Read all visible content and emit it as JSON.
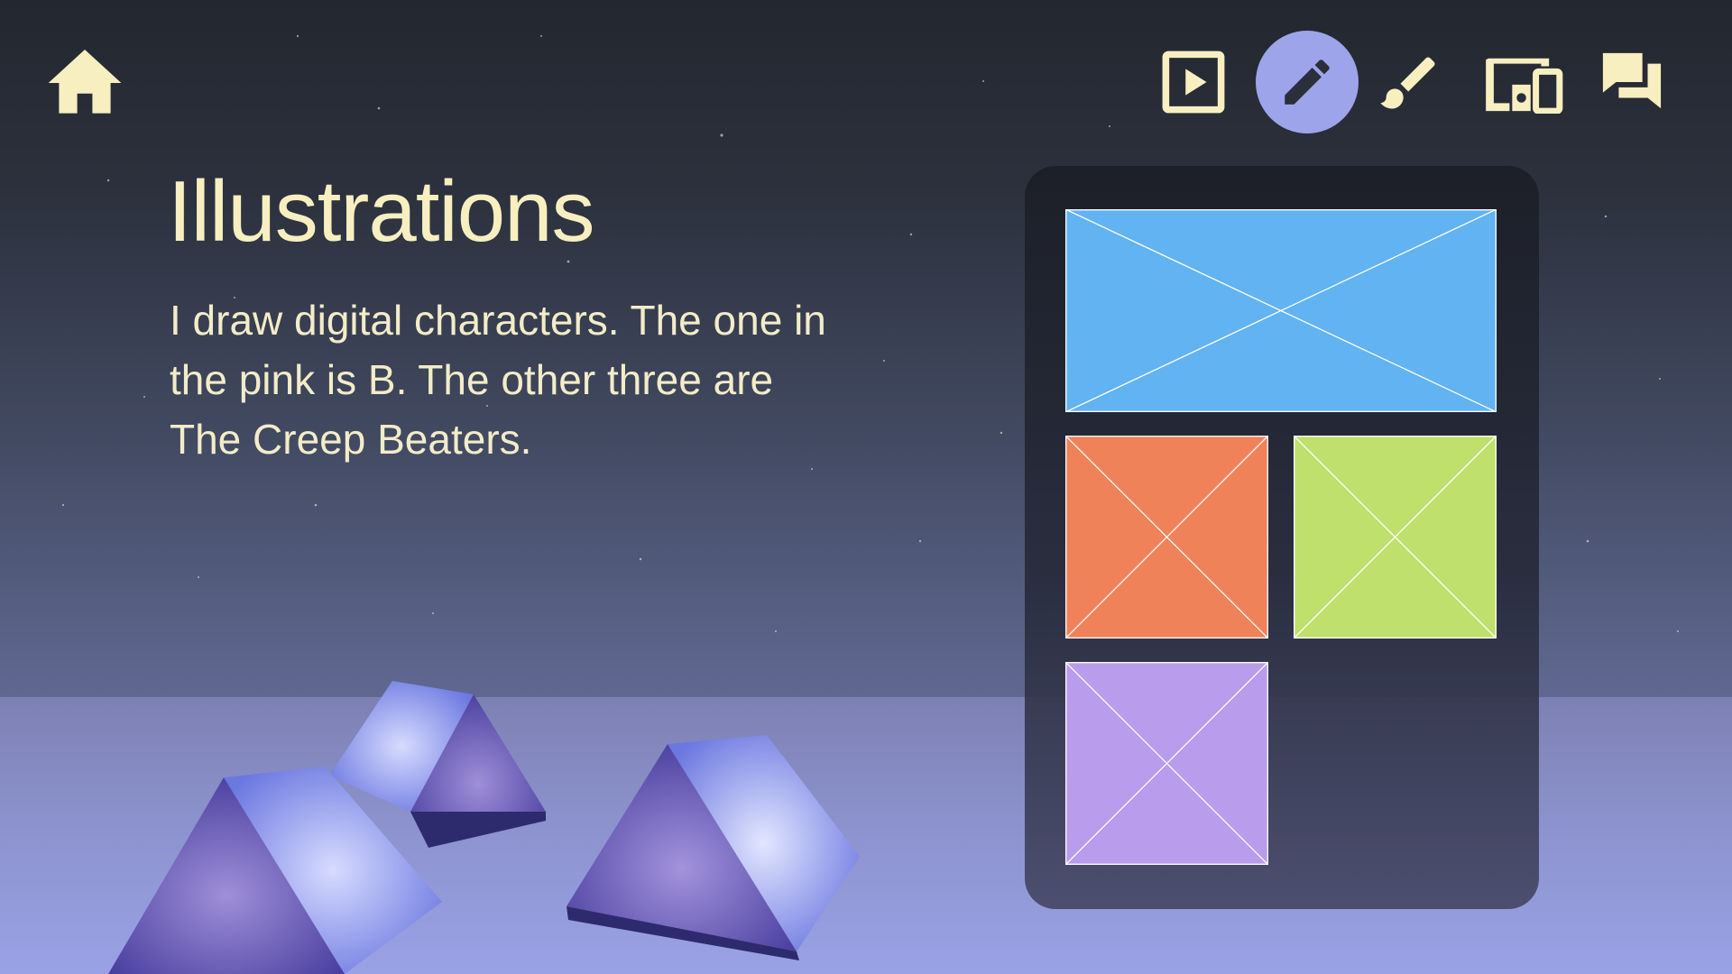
{
  "page": {
    "title": "Illustrations",
    "description": "I draw digital characters. The one in the pink is B. The other three are The Creep Beaters."
  },
  "nav": {
    "home": {
      "icon": "home-icon"
    },
    "items": [
      {
        "id": "video",
        "icon": "play-icon",
        "active": false
      },
      {
        "id": "illustrations",
        "icon": "pencil-icon",
        "active": true
      },
      {
        "id": "paint",
        "icon": "paintbrush-icon",
        "active": false
      },
      {
        "id": "devices",
        "icon": "devices-icon",
        "active": false
      },
      {
        "id": "contact",
        "icon": "chat-icon",
        "active": false
      }
    ]
  },
  "gallery": {
    "tiles": [
      {
        "color": "#62b3f2"
      },
      {
        "color": "#f0825a"
      },
      {
        "color": "#bfe06c"
      },
      {
        "color": "#b99cec"
      }
    ]
  },
  "colors": {
    "accent_text": "#f8efc0",
    "active_nav_bg": "#9da4ea",
    "icon": "#f8efc0"
  }
}
